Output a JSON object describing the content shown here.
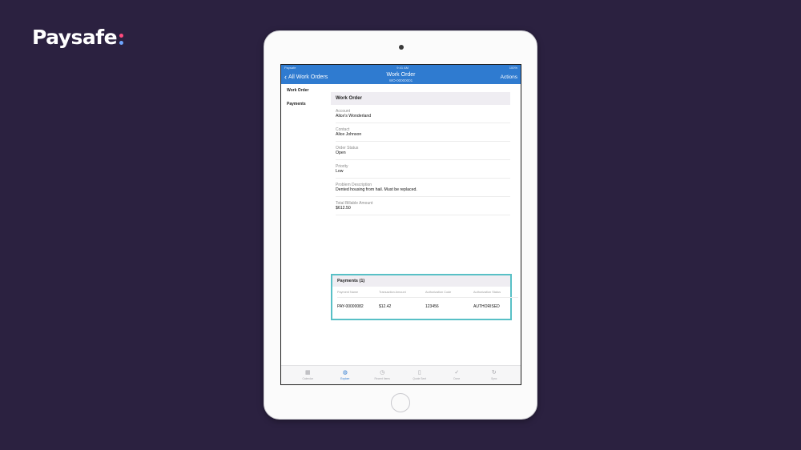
{
  "brand": {
    "name": "Paysafe"
  },
  "status_bar": {
    "carrier": "Paysafe",
    "time": "9:41 AM",
    "battery": "100%"
  },
  "nav": {
    "back_label": "All Work Orders",
    "title": "Work Order",
    "subtitle": "WO-00000001",
    "actions_label": "Actions"
  },
  "sidebar": {
    "items": [
      {
        "label": "Work Order"
      },
      {
        "label": "Payments"
      }
    ]
  },
  "work_order": {
    "header": "Work Order",
    "fields": [
      {
        "label": "Account",
        "value": "Alice's Wonderland"
      },
      {
        "label": "Contact",
        "value": "Alice Johnson"
      },
      {
        "label": "Order Status",
        "value": "Open"
      },
      {
        "label": "Priority",
        "value": "Low"
      },
      {
        "label": "Problem Description",
        "value": "Dented housing from hail. Must be replaced."
      },
      {
        "label": "Total Billable Amount",
        "value": "$612.50"
      }
    ]
  },
  "payments": {
    "header": "Payments (1)",
    "columns": [
      "Payment Name",
      "Transaction Amount",
      "Authorization Code",
      "Authorization Status"
    ],
    "rows": [
      [
        "PAY-00000082",
        "$12.42",
        "123456",
        "AUTHORISED"
      ]
    ]
  },
  "tabbar": {
    "items": [
      {
        "label": "Calendar",
        "icon": "calendar-icon",
        "active": false
      },
      {
        "label": "Explore",
        "icon": "globe-icon",
        "active": true
      },
      {
        "label": "Recent Items",
        "icon": "clock-icon",
        "active": false
      },
      {
        "label": "Quote Sent",
        "icon": "document-icon",
        "active": false
      },
      {
        "label": "Done",
        "icon": "check-icon",
        "active": false
      },
      {
        "label": "Sync",
        "icon": "sync-icon",
        "active": false
      }
    ]
  },
  "colors": {
    "background": "#2b2140",
    "nav_blue": "#2f7bd0",
    "highlight": "#58c0c6"
  }
}
